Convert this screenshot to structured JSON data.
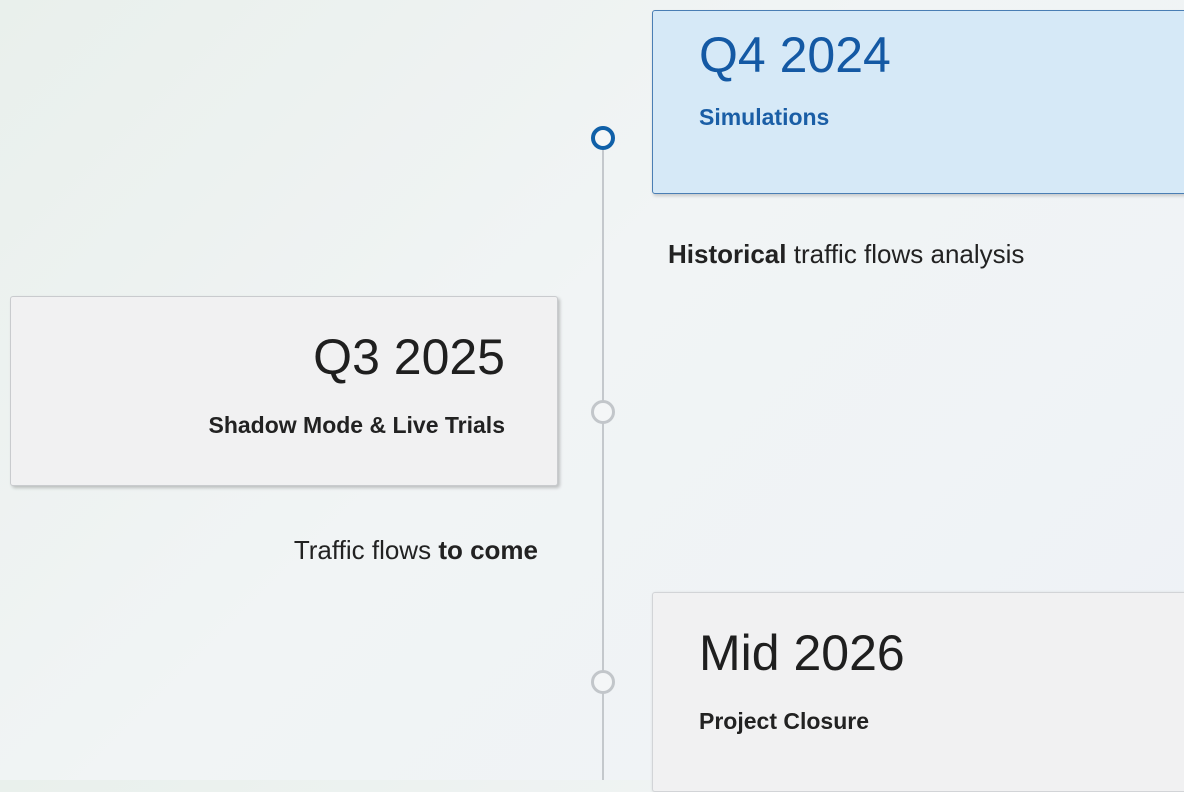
{
  "milestones": [
    {
      "date": "Q4 2024",
      "title": "Simulations",
      "description": {
        "strong": "Historical",
        "rest": " traffic flows analysis"
      },
      "state": "active"
    },
    {
      "date": "Q3 2025",
      "title": "Shadow Mode & Live Trials",
      "description": {
        "lead": "Traffic flows ",
        "strong": "to come"
      },
      "state": "upcoming"
    },
    {
      "date": "Mid 2026",
      "title": "Project Closure",
      "state": "upcoming"
    }
  ],
  "colors": {
    "active_accent": "#1060a8",
    "active_card_fill": "#d6e9f7",
    "inactive_node": "#c2c6ca",
    "timeline_line": "#c4c8cc",
    "card_fill": "#f1f1f2"
  }
}
